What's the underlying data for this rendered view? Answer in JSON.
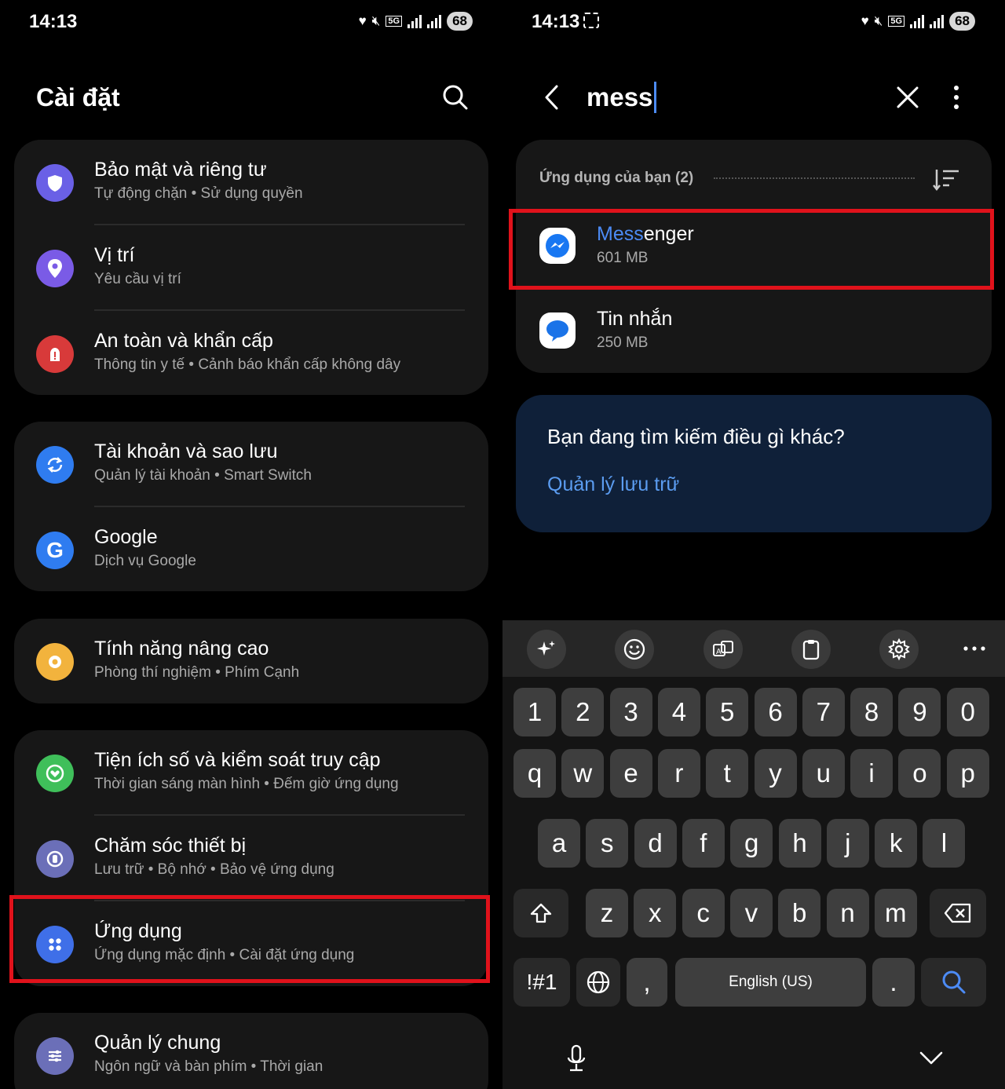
{
  "left": {
    "status": {
      "time": "14:13",
      "battery": "68"
    },
    "title": "Cài đặt",
    "groups": [
      {
        "items": [
          {
            "title": "Bảo mật và riêng tư",
            "subtitle": "Tự động chặn  •  Sử dụng quyền"
          },
          {
            "title": "Vị trí",
            "subtitle": "Yêu cầu vị trí"
          },
          {
            "title": "An toàn và khẩn cấp",
            "subtitle": "Thông tin y tế  •  Cảnh báo khẩn cấp không dây"
          }
        ]
      },
      {
        "items": [
          {
            "title": "Tài khoản và sao lưu",
            "subtitle": "Quản lý tài khoản  •  Smart Switch"
          },
          {
            "title": "Google",
            "subtitle": "Dịch vụ Google"
          }
        ]
      },
      {
        "items": [
          {
            "title": "Tính năng nâng cao",
            "subtitle": "Phòng thí nghiệm  •  Phím Cạnh"
          }
        ]
      },
      {
        "items": [
          {
            "title": "Tiện ích số và kiểm soát truy cập",
            "subtitle": "Thời gian sáng màn hình  •  Đếm giờ ứng dụng"
          },
          {
            "title": "Chăm sóc thiết bị",
            "subtitle": "Lưu trữ  •  Bộ nhớ  •  Bảo vệ ứng dụng"
          },
          {
            "title": "Ứng dụng",
            "subtitle": "Ứng dụng mặc định  •  Cài đặt ứng dụng"
          }
        ]
      },
      {
        "items": [
          {
            "title": "Quản lý chung",
            "subtitle": "Ngôn ngữ và bàn phím  •  Thời gian"
          }
        ]
      }
    ]
  },
  "right": {
    "status": {
      "time": "14:13",
      "battery": "68"
    },
    "search": {
      "query": "mess"
    },
    "results": {
      "section_label": "Ứng dụng của bạn (2)",
      "apps": [
        {
          "match": "Mess",
          "rest": "enger",
          "size": "601 MB"
        },
        {
          "title": "Tin nhắn",
          "size": "250 MB"
        }
      ]
    },
    "other": {
      "question": "Bạn đang tìm kiếm điều gì khác?",
      "link": "Quản lý lưu trữ"
    },
    "keyboard": {
      "numbers": [
        "1",
        "2",
        "3",
        "4",
        "5",
        "6",
        "7",
        "8",
        "9",
        "0"
      ],
      "row1": [
        "q",
        "w",
        "e",
        "r",
        "t",
        "y",
        "u",
        "i",
        "o",
        "p"
      ],
      "row2": [
        "a",
        "s",
        "d",
        "f",
        "g",
        "h",
        "j",
        "k",
        "l"
      ],
      "row3": [
        "z",
        "x",
        "c",
        "v",
        "b",
        "n",
        "m"
      ],
      "symbols": "!#1",
      "comma": ",",
      "space": "English (US)",
      "period": "."
    }
  },
  "colors": {
    "accent": "#4c8bf5",
    "highlight": "#e0121b",
    "card": "#171717"
  }
}
